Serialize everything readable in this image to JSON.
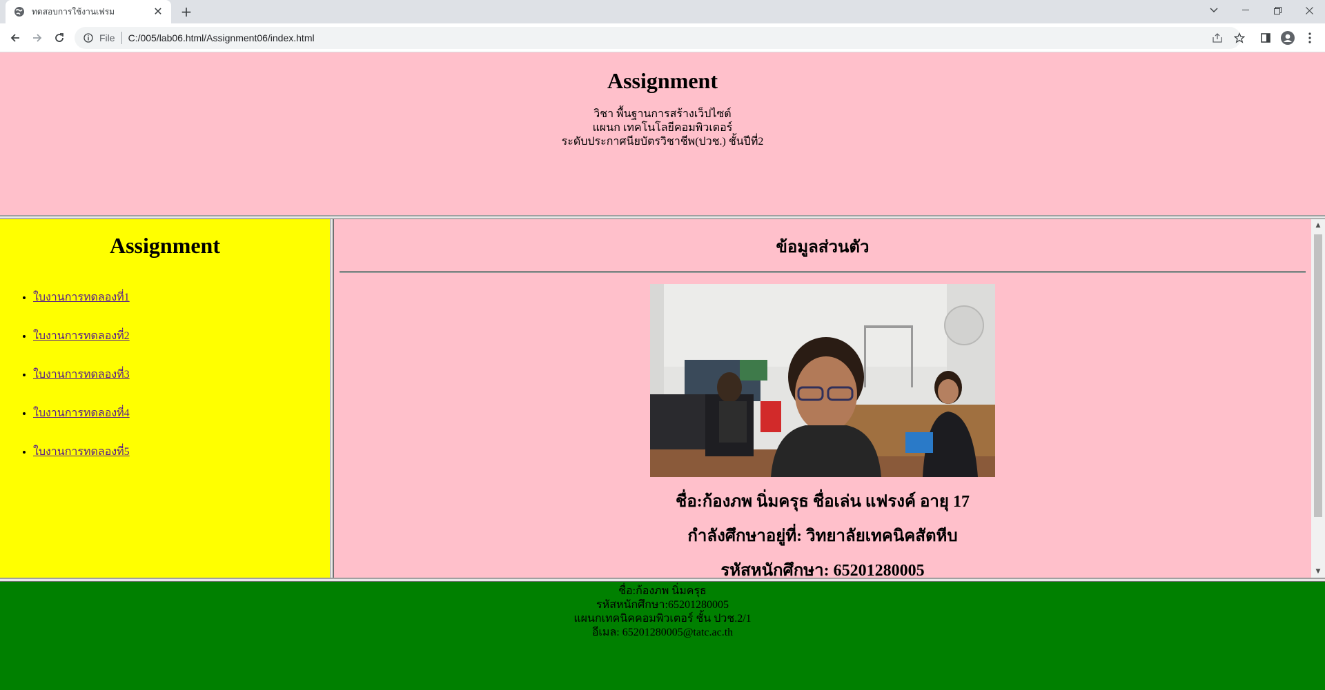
{
  "browser": {
    "tab_title": "ทดสอบการใช้งานเฟรม",
    "address_scheme": "File",
    "address_url": "C:/005/lab06.html/Assignment06/index.html"
  },
  "header": {
    "title": "Assignment",
    "lines": [
      "วิชา พื้นฐานการสร้างเว็ปไซต์",
      "แผนก เทคโนโลยีคอมพิวเตอร์",
      "ระดับประกาศนียบัตรวิชาชีพ(ปวช.) ชั้นปีที่2"
    ]
  },
  "sidebar": {
    "title": "Assignment",
    "links": [
      "ใบงานการทดลองที่1",
      "ใบงานการทดลองที่2",
      "ใบงานการทดลองที่3",
      "ใบงานการทดลองที่4",
      "ใบงานการทดลองที่5"
    ]
  },
  "main": {
    "heading": "ข้อมูลส่วนตัว",
    "name_line": "ชื่อ:ก้องภพ นิ่มครุธ ชื่อเล่น แฟรงค์ อายุ 17",
    "school_line": "กำลังศึกษาอยู่ที่: วิทยาลัยเทคนิคสัตหีบ",
    "id_line": "รหัสหนักศึกษา: 65201280005"
  },
  "footer": {
    "lines": [
      "ชื่อ:ก้องภพ นิ่มครุธ",
      "รหัสหนักศึกษา:65201280005",
      "แผนกเทคนิคคอมพิวเตอร์ ชั้น ปวช.2/1",
      "อีเมล: 65201280005@tatc.ac.th"
    ]
  },
  "colors": {
    "header_bg": "#ffc0cb",
    "sidebar_bg": "#ffff00",
    "main_bg": "#ffc0cb",
    "footer_bg": "#008000"
  },
  "icons": [
    "globe-icon",
    "close-icon",
    "plus-icon",
    "chevron-down-icon",
    "minimize-icon",
    "restore-icon",
    "back-icon",
    "forward-icon",
    "reload-icon",
    "info-icon",
    "share-icon",
    "star-icon",
    "sidepanel-icon",
    "profile-icon",
    "menu-icon"
  ]
}
